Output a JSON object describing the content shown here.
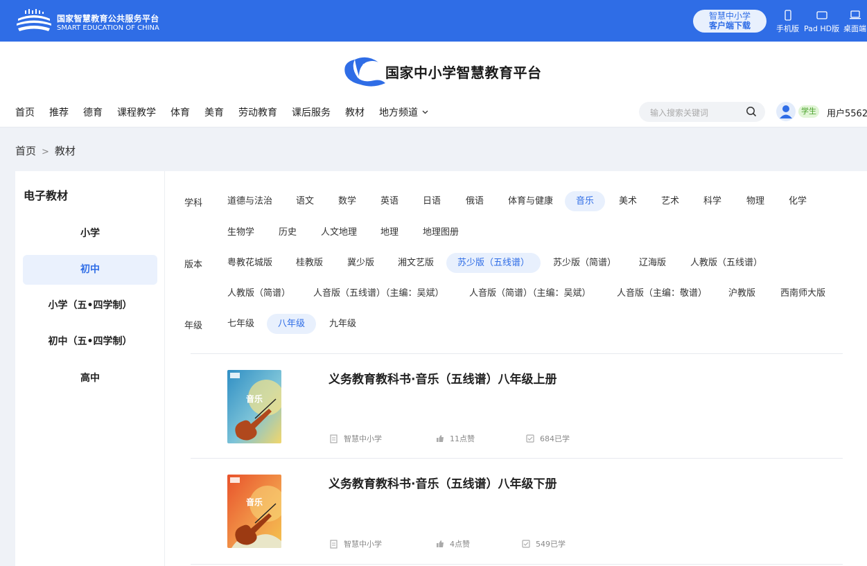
{
  "topbar": {
    "org_cn": "国家智慧教育公共服务平台",
    "org_en": "SMART EDUCATION OF CHINA",
    "download_line1": "智慧中小学",
    "download_line2": "客户端下载",
    "devices": [
      "手机版",
      "Pad HD版",
      "桌面端"
    ]
  },
  "brand": {
    "title": "国家中小学智慧教育平台"
  },
  "nav": {
    "items": [
      "首页",
      "推荐",
      "德育",
      "课程教学",
      "体育",
      "美育",
      "劳动教育",
      "课后服务",
      "教材",
      "地方频道"
    ],
    "search_placeholder": "输入搜索关键词",
    "role": "学生",
    "user": "用户5562"
  },
  "breadcrumb": {
    "home": "首页",
    "sep": ">",
    "current": "教材"
  },
  "sidebar": {
    "title": "电子教材",
    "items": [
      "小学",
      "初中",
      "小学（五•四学制）",
      "初中（五•四学制）",
      "高中"
    ],
    "active": "初中"
  },
  "filters": {
    "subject_label": "学科",
    "subjects": [
      "道德与法治",
      "语文",
      "数学",
      "英语",
      "日语",
      "俄语",
      "体育与健康",
      "音乐",
      "美术",
      "艺术",
      "科学",
      "物理",
      "化学",
      "生物学",
      "历史",
      "人文地理",
      "地理",
      "地理图册"
    ],
    "subject_active": "音乐",
    "edition_label": "版本",
    "editions": [
      "粤教花城版",
      "桂教版",
      "冀少版",
      "湘文艺版",
      "苏少版（五线谱）",
      "苏少版（简谱）",
      "辽海版",
      "人教版（五线谱）",
      "人教版（简谱）",
      "人音版（五线谱）（主编：吴斌）",
      "人音版（简谱）（主编：吴斌）",
      "人音版（主编：敬谱）",
      "沪教版",
      "西南师大版"
    ],
    "edition_active": "苏少版（五线谱）",
    "grade_label": "年级",
    "grades": [
      "七年级",
      "八年级",
      "九年级"
    ],
    "grade_active": "八年级"
  },
  "books": [
    {
      "title": "义务教育教科书·音乐（五线谱）八年级上册",
      "cover_text": "音乐",
      "source": "智慧中小学",
      "likes": "11点赞",
      "learners": "684已学",
      "cover_colors": [
        "#2f8ec4",
        "#f2d66a"
      ]
    },
    {
      "title": "义务教育教科书·音乐（五线谱）八年级下册",
      "cover_text": "音乐",
      "source": "智慧中小学",
      "likes": "4点赞",
      "learners": "549已学",
      "cover_colors": [
        "#e8522b",
        "#f4c34e"
      ]
    }
  ],
  "colors": {
    "primary": "#2f6de6",
    "chip_active_bg": "#e8f0fd"
  }
}
